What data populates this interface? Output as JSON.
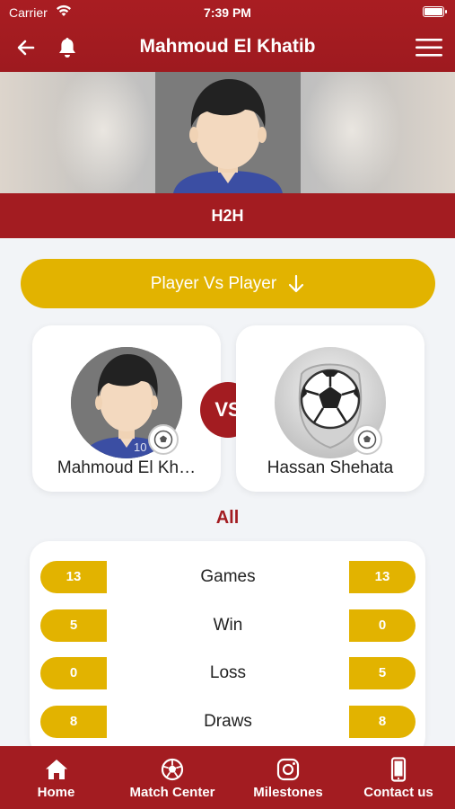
{
  "status_bar": {
    "carrier": "Carrier",
    "time": "7:39 PM"
  },
  "header": {
    "title": "Mahmoud El Khatib"
  },
  "subheader": {
    "label": "H2H"
  },
  "compare_selector": {
    "label": "Player Vs Player"
  },
  "player_left": {
    "name": "Mahmoud El Kh…",
    "jersey_number": "10"
  },
  "player_right": {
    "name": "Hassan Shehata"
  },
  "vs_label": "VS",
  "filter": {
    "label": "All"
  },
  "stats": [
    {
      "label": "Games",
      "left": "13",
      "right": "13"
    },
    {
      "label": "Win",
      "left": "5",
      "right": "0"
    },
    {
      "label": "Loss",
      "left": "0",
      "right": "5"
    },
    {
      "label": "Draws",
      "left": "8",
      "right": "8"
    }
  ],
  "tabs": [
    {
      "label": "Home",
      "icon": "home-icon"
    },
    {
      "label": "Match Center",
      "icon": "soccer-ball-icon"
    },
    {
      "label": "Milestones",
      "icon": "instagram-icon"
    },
    {
      "label": "Contact us",
      "icon": "phone-icon"
    }
  ],
  "colors": {
    "primary_red": "#a31c21",
    "accent_yellow": "#e2b300",
    "background": "#f2f4f7"
  }
}
